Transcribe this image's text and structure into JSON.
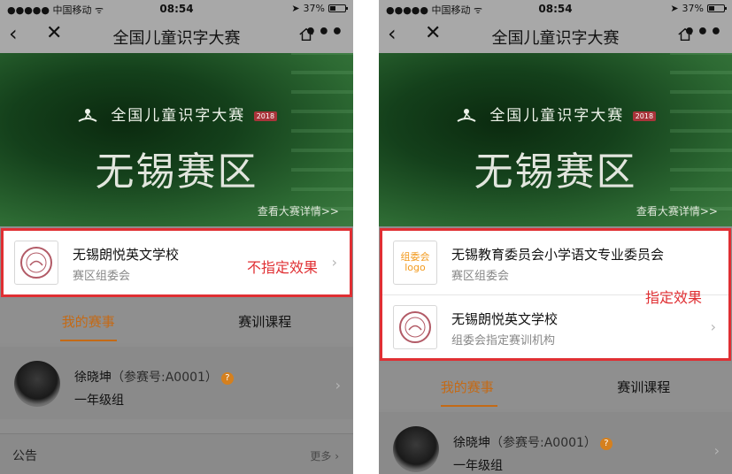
{
  "status": {
    "carrier": "●●●●● 中国移动 ᯤ",
    "time": "08:54",
    "battery": "37%"
  },
  "nav": {
    "title": "全国儿童识字大赛",
    "back_icon": "‹",
    "close_icon": "✕",
    "more_icon": "•••"
  },
  "banner": {
    "logo_text": "全国儿童识字大赛",
    "year": "2018",
    "region": "无锡赛区",
    "detail_link": "查看大赛详情>>"
  },
  "left": {
    "org": {
      "name": "无锡朗悦英文学校",
      "subtitle": "赛区组委会",
      "note": "不指定效果"
    },
    "tabs": [
      "我的赛事",
      "赛训课程"
    ],
    "user": {
      "name": "徐晓坤",
      "number": "（参赛号:A0001）",
      "group": "一年级组"
    },
    "announcement": {
      "label": "公告",
      "more": "更多 ›"
    }
  },
  "right": {
    "orgs": [
      {
        "name": "无锡教育委员会小学语文专业委员会",
        "subtitle": "赛区组委会",
        "logo_text_1": "组委会",
        "logo_text_2": "logo"
      },
      {
        "name": "无锡朗悦英文学校",
        "subtitle": "组委会指定赛训机构"
      }
    ],
    "note": "指定效果",
    "tabs": [
      "我的赛事",
      "赛训课程"
    ],
    "user": {
      "name": "徐晓坤",
      "number": "（参赛号:A0001）",
      "group": "一年级组"
    }
  },
  "colors": {
    "highlight": "#e02f33",
    "accent": "#c46a16",
    "banner": "#2d6a33"
  }
}
